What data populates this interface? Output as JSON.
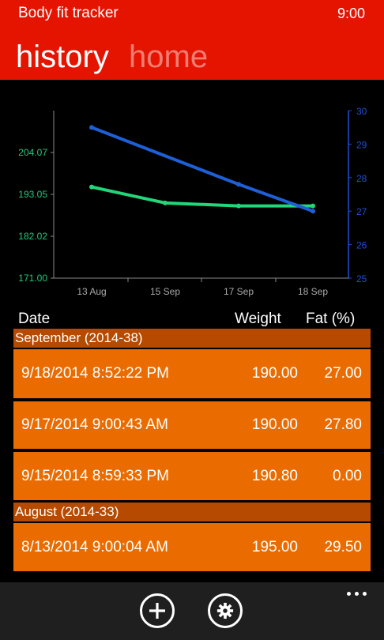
{
  "app": {
    "title": "Body fit tracker",
    "time": "9:00"
  },
  "pivot": {
    "active": "history",
    "inactive": "home"
  },
  "colors": {
    "header": "#e51400",
    "group": "#b64a00",
    "row": "#ea6c00",
    "weight_axis": "#22c97a",
    "fat_axis": "#1f4fd1"
  },
  "chart_data": {
    "type": "line",
    "categories": [
      "13 Aug",
      "15 Sep",
      "17 Sep",
      "18 Sep"
    ],
    "y_left": {
      "ticks": [
        "171.00",
        "182.02",
        "193.05",
        "204.07"
      ],
      "range": [
        171.0,
        215.1
      ]
    },
    "y_right": {
      "ticks": [
        "25",
        "26",
        "27",
        "28",
        "29",
        "30"
      ],
      "range": [
        25,
        30
      ]
    },
    "series": [
      {
        "axis": "left",
        "color": "#22d67a",
        "values": [
          195.0,
          190.8,
          190.0,
          190.0
        ]
      },
      {
        "axis": "right",
        "color": "#1f5fd6",
        "values": [
          29.5,
          null,
          27.8,
          27.0
        ]
      }
    ],
    "grid": false
  },
  "table": {
    "headers": {
      "date": "Date",
      "weight": "Weight",
      "fat": "Fat (%)"
    },
    "groups": [
      {
        "label": "September (2014-38)",
        "rows": [
          {
            "date": "9/18/2014 8:52:22 PM",
            "weight": "190.00",
            "fat": "27.00"
          },
          {
            "date": "9/17/2014 9:00:43 AM",
            "weight": "190.00",
            "fat": "27.80"
          },
          {
            "date": "9/15/2014 8:59:33 PM",
            "weight": "190.80",
            "fat": "0.00"
          }
        ]
      },
      {
        "label": "August (2014-33)",
        "rows": [
          {
            "date": "8/13/2014 9:00:04 AM",
            "weight": "195.00",
            "fat": "29.50"
          }
        ]
      }
    ]
  },
  "appbar": {
    "add_icon": "add-icon",
    "settings_icon": "gear-icon",
    "more_icon": "more-icon"
  }
}
